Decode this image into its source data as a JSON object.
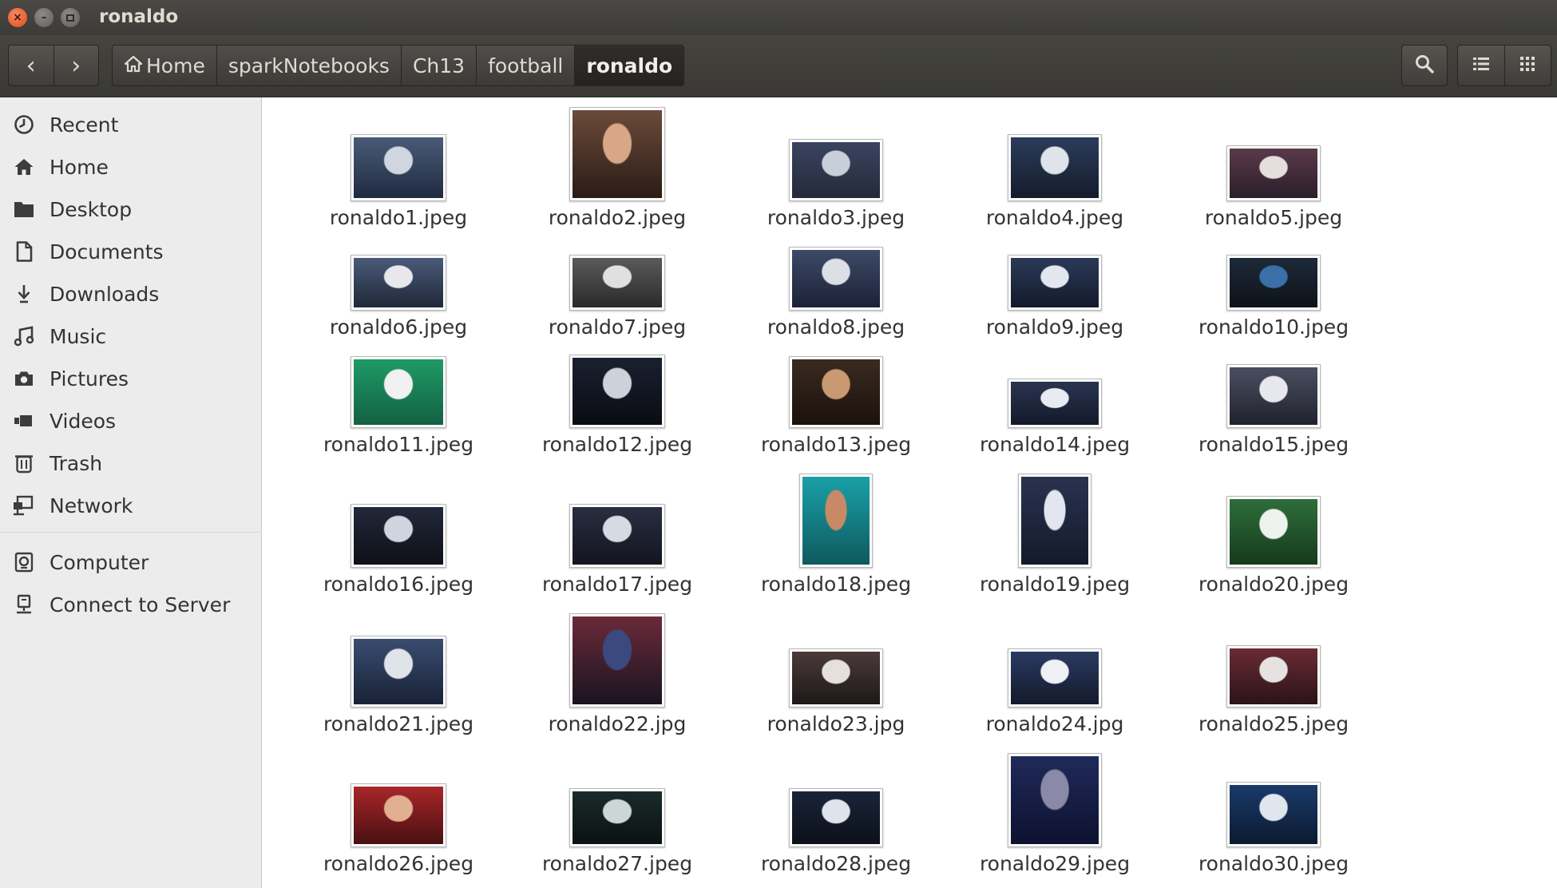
{
  "window": {
    "title": "ronaldo",
    "controls": {
      "close": "×",
      "minimize": "–"
    }
  },
  "toolbar": {
    "back_glyph": "‹",
    "forward_glyph": "›",
    "breadcrumbs": [
      "Home",
      "sparkNotebooks",
      "Ch13",
      "football",
      "ronaldo"
    ],
    "active_crumb": "ronaldo"
  },
  "sidebar": {
    "items": [
      {
        "label": "Recent",
        "icon": "clock-icon"
      },
      {
        "label": "Home",
        "icon": "home-icon"
      },
      {
        "label": "Desktop",
        "icon": "folder-icon"
      },
      {
        "label": "Documents",
        "icon": "document-icon"
      },
      {
        "label": "Downloads",
        "icon": "download-icon"
      },
      {
        "label": "Music",
        "icon": "music-icon"
      },
      {
        "label": "Pictures",
        "icon": "camera-icon"
      },
      {
        "label": "Videos",
        "icon": "video-icon"
      },
      {
        "label": "Trash",
        "icon": "trash-icon"
      },
      {
        "label": "Network",
        "icon": "network-icon"
      },
      {
        "label": "Computer",
        "icon": "computer-icon"
      },
      {
        "label": "Connect to Server",
        "icon": "server-icon"
      }
    ]
  },
  "files": [
    "ronaldo1.jpeg",
    "ronaldo2.jpeg",
    "ronaldo3.jpeg",
    "ronaldo4.jpeg",
    "ronaldo5.jpeg",
    "ronaldo6.jpeg",
    "ronaldo7.jpeg",
    "ronaldo8.jpeg",
    "ronaldo9.jpeg",
    "ronaldo10.jpeg",
    "ronaldo11.jpeg",
    "ronaldo12.jpeg",
    "ronaldo13.jpeg",
    "ronaldo14.jpeg",
    "ronaldo15.jpeg",
    "ronaldo16.jpeg",
    "ronaldo17.jpeg",
    "ronaldo18.jpeg",
    "ronaldo19.jpeg",
    "ronaldo20.jpeg",
    "ronaldo21.jpeg",
    "ronaldo22.jpg",
    "ronaldo23.jpg",
    "ronaldo24.jpg",
    "ronaldo25.jpeg",
    "ronaldo26.jpeg",
    "ronaldo27.jpeg",
    "ronaldo28.jpeg",
    "ronaldo29.jpeg",
    "ronaldo30.jpeg"
  ],
  "colors": {
    "titlebar": "#3c3b37",
    "sidebar_bg": "#ececec",
    "close_button": "#df4a16"
  }
}
